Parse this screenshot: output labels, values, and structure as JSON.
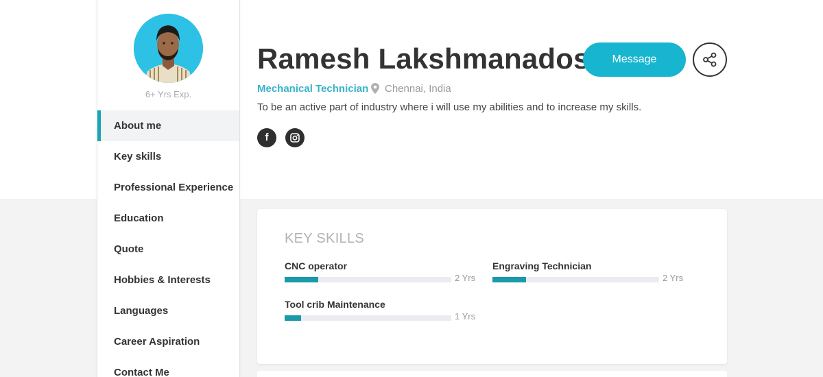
{
  "profile": {
    "name": "Ramesh Lakshmanadoss",
    "experience": "6+ Yrs Exp.",
    "role": "Mechanical Technician",
    "location": "Chennai, India",
    "objective": "To be an active part of industry where i will use my abilities and to increase my skills.",
    "avatar_icon": "person-photo",
    "message_label": "Message",
    "share_icon": "share-icon",
    "social": [
      {
        "icon": "facebook-icon",
        "label": "f"
      },
      {
        "icon": "instagram-icon"
      }
    ]
  },
  "sidebar": {
    "items": [
      {
        "label": "About me",
        "active": true
      },
      {
        "label": "Key skills"
      },
      {
        "label": "Professional Experience"
      },
      {
        "label": "Education"
      },
      {
        "label": "Quote"
      },
      {
        "label": "Hobbies & Interests"
      },
      {
        "label": "Languages"
      },
      {
        "label": "Career Aspiration"
      },
      {
        "label": "Contact Me"
      }
    ]
  },
  "key_skills": {
    "title": "KEY SKILLS",
    "skills": [
      {
        "name": "CNC operator",
        "years": "2 Yrs",
        "level": 0.2
      },
      {
        "name": "Engraving Technician",
        "years": "2 Yrs",
        "level": 0.2
      },
      {
        "name": "Tool crib Maintenance",
        "years": "1 Yrs",
        "level": 0.1
      }
    ]
  },
  "colors": {
    "accent": "#17b5cf",
    "bar": "#1a9aa8",
    "avatar_bg": "#2ec1e6"
  }
}
